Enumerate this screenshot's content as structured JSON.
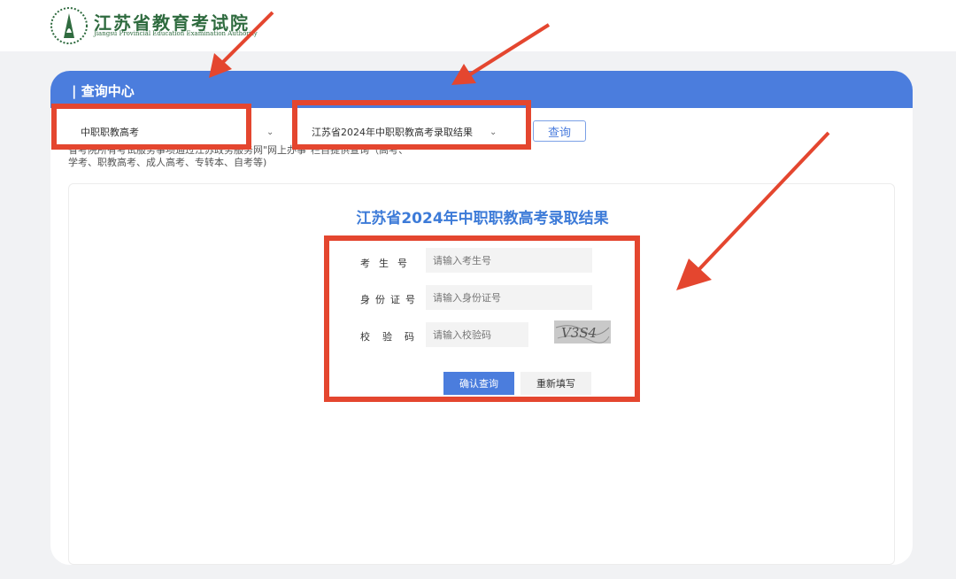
{
  "header": {
    "title": "江苏省教育考试院",
    "subtitle": "Jiangsu Provincial Education Examination Authority"
  },
  "card": {
    "title": "| 查询中心",
    "exam_type_select": "中职职教高考",
    "result_select": "江苏省2024年中职职教高考录取结果",
    "query_button": "查询",
    "notice_line1": "省考院所有考试服务事项通过江苏政务服务网\"网上办事\"栏目提供查询（高考、",
    "notice_line2": "学考、职教高考、成人高考、专转本、自考等)"
  },
  "form": {
    "title": "江苏省2024年中职职教高考录取结果",
    "exam_no_label": "考生号",
    "exam_no_placeholder": "请输入考生号",
    "id_label": "身份证号",
    "id_placeholder": "请输入身份证号",
    "captcha_label": "校验码",
    "captcha_placeholder": "请输入校验码",
    "captcha_text": "V3S4",
    "confirm_button": "确认查询",
    "reset_button": "重新填写"
  },
  "colors": {
    "accent": "#4b7ddd",
    "title_blue": "#3d7bd8",
    "annotation_red": "#e4462f",
    "logo_green": "#2f6b3f"
  }
}
